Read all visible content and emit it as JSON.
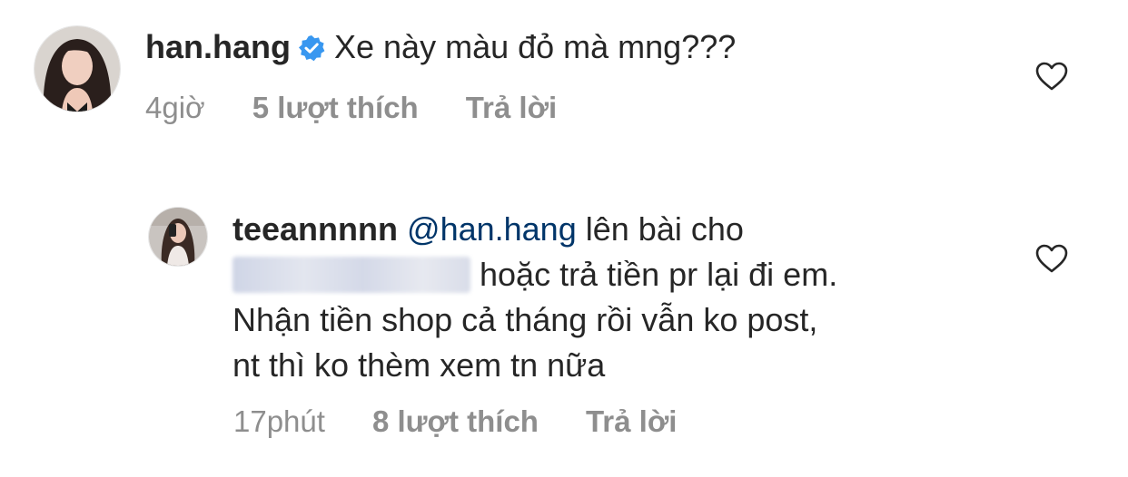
{
  "comments": [
    {
      "username": "han.hang",
      "verified": true,
      "text": "Xe này màu đỏ mà mng???",
      "time": "4giờ",
      "likes": "5 lượt thích",
      "reply_label": "Trả lời",
      "avatar": "avatar-han-hang"
    },
    {
      "username": "teeannnnn",
      "mention": "@han.hang",
      "text_line1": "lên bài cho",
      "text_line2": "hoặc trả tiền pr lại đi em.",
      "text_line3": "Nhận tiền shop cả tháng rồi vẫn ko post,",
      "text_line4": "nt thì ko thèm xem tn nữa",
      "time": "17phút",
      "likes": "8 lượt thích",
      "reply_label": "Trả lời",
      "avatar": "avatar-teeannnnn"
    }
  ],
  "icons": {
    "like": "heart-outline-icon",
    "verified": "verified-badge-icon"
  },
  "colors": {
    "text": "#262626",
    "meta": "#8e8e8e",
    "mention": "#003569",
    "verified": "#3897f0"
  }
}
